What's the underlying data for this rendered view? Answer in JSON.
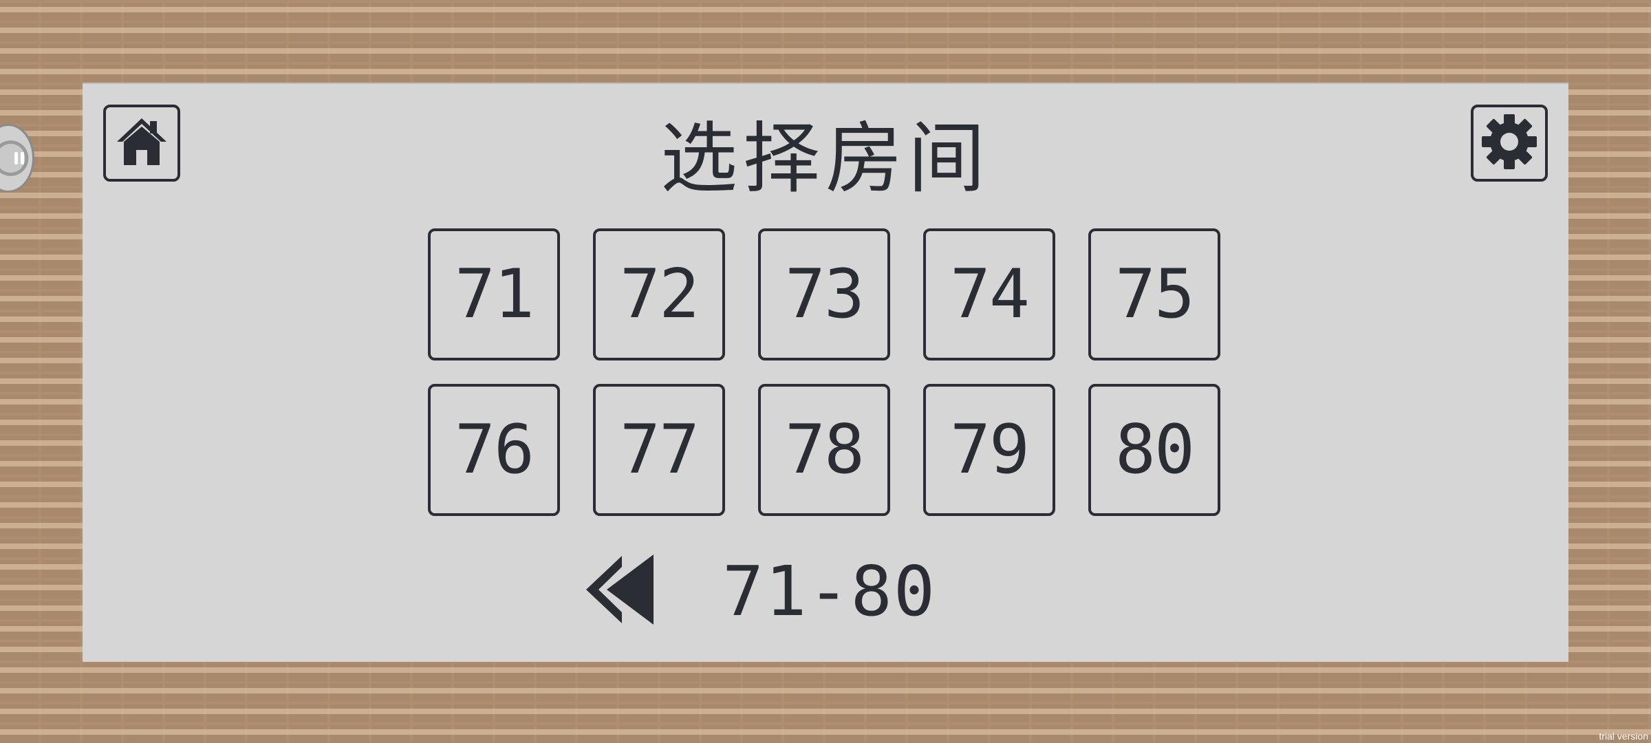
{
  "title": "选择房间",
  "rooms": [
    "71",
    "72",
    "73",
    "74",
    "75",
    "76",
    "77",
    "78",
    "79",
    "80"
  ],
  "pager": {
    "range": "71-80"
  },
  "icons": {
    "home": "home-icon",
    "settings": "gear-icon",
    "previous": "double-chevron-left-icon"
  },
  "watermark": "trial version",
  "colors": {
    "panel": "#d6d6d6",
    "ink": "#2a2d33",
    "brick": "#d8bc9d",
    "mortar": "#a9896b"
  }
}
